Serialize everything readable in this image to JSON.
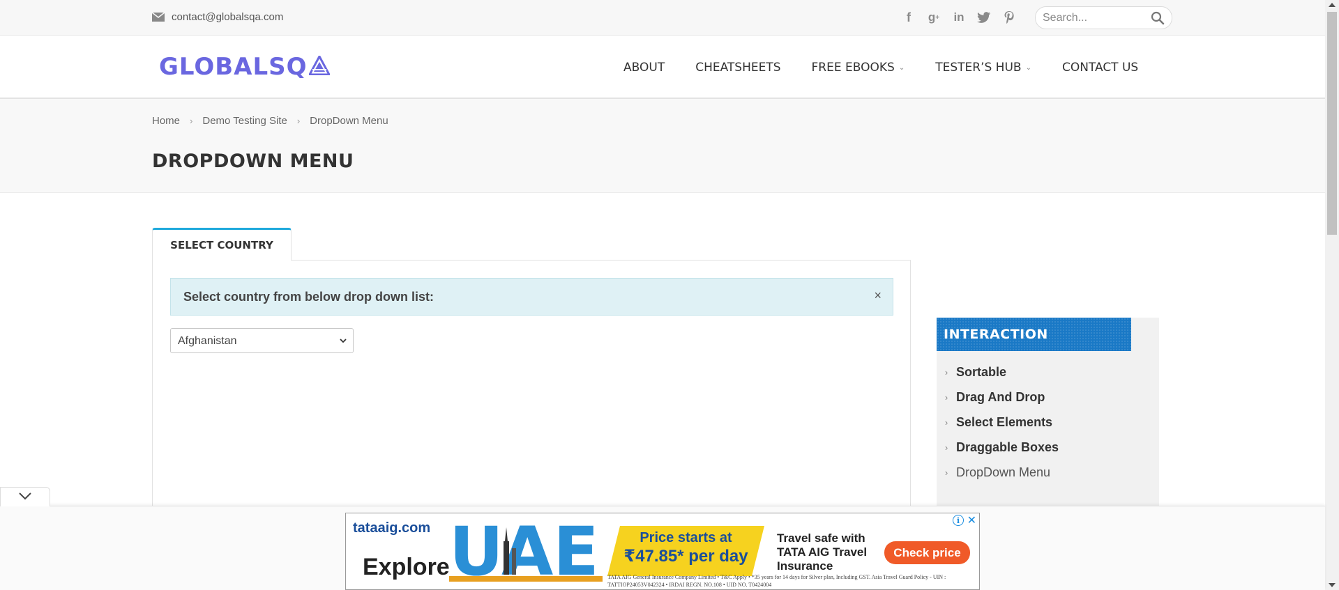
{
  "topbar": {
    "email": "contact@globalsqa.com",
    "social": [
      {
        "icon": "facebook-icon",
        "glyph": "f"
      },
      {
        "icon": "google-plus-icon",
        "glyph": "g+"
      },
      {
        "icon": "linkedin-icon",
        "glyph": "in"
      },
      {
        "icon": "twitter-icon",
        "glyph": "t"
      },
      {
        "icon": "pinterest-icon",
        "glyph": "p"
      }
    ],
    "search_placeholder": "Search..."
  },
  "header": {
    "logo_text": "GLOBALSQ",
    "nav": [
      {
        "label": "ABOUT",
        "dropdown": false
      },
      {
        "label": "CHEATSHEETS",
        "dropdown": false
      },
      {
        "label": "FREE EBOOKS",
        "dropdown": true
      },
      {
        "label": "TESTER’S HUB",
        "dropdown": true
      },
      {
        "label": "CONTACT US",
        "dropdown": false
      }
    ]
  },
  "breadcrumb": [
    "Home",
    "Demo Testing Site",
    "DropDown Menu"
  ],
  "page_title": "DROPDOWN MENU",
  "main": {
    "tab_label": "SELECT COUNTRY",
    "alert_text": "Select country from below drop down list:",
    "alert_close": "×",
    "country_selected": "Afghanistan"
  },
  "sidebar": {
    "heading": "INTERACTION",
    "items": [
      {
        "label": "Sortable",
        "active": false
      },
      {
        "label": "Drag And Drop",
        "active": false
      },
      {
        "label": "Select Elements",
        "active": false
      },
      {
        "label": "Draggable Boxes",
        "active": false
      },
      {
        "label": "DropDown Menu",
        "active": true
      }
    ]
  },
  "ad": {
    "brand": "tataaig.com",
    "headline": "Explore",
    "price_line1": "Price starts at",
    "price_line2": "₹47.85* per day",
    "tagline": "Travel safe with TATA AIG Travel Insurance",
    "cta": "Check price",
    "fine_print": "TATA AIG General Insurance Company Limited • T&C Apply • *35 years for 14 days for Silver plan, Including GST. Asia Travel Guard Policy - UIN : TATTIOP24053V042324 • IRDAI REGN. NO.108 • UID NO. T0424004",
    "info": "i",
    "close": "✕"
  },
  "colors": {
    "accent": "#1fa9dc",
    "logo": "#6a67e0",
    "sidebar_head": "#1a79c6",
    "alert_bg": "#dff1f5"
  }
}
